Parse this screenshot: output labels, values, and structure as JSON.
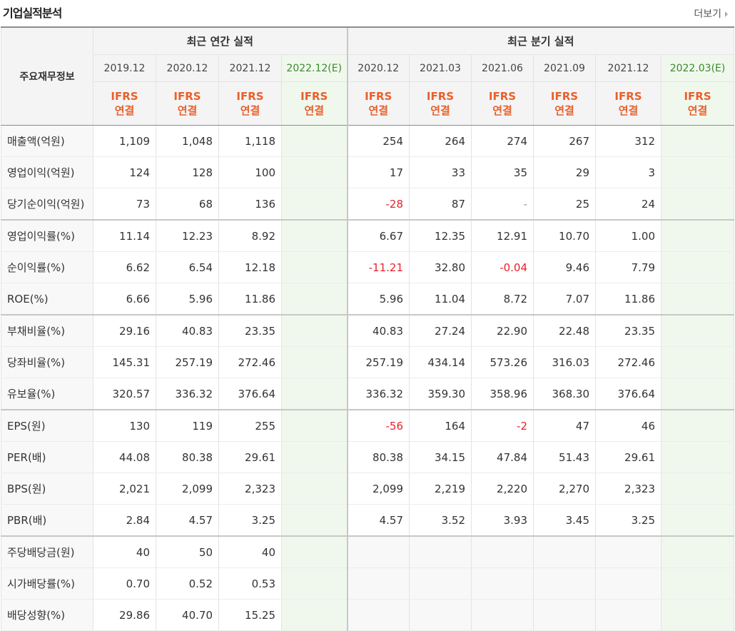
{
  "header": {
    "title": "기업실적분석",
    "more_label": "더보기"
  },
  "table": {
    "row_header_label": "주요재무정보",
    "groups": {
      "annual": "최근 연간 실적",
      "quarter": "최근 분기 실적"
    },
    "columns": [
      {
        "period": "2019.12",
        "basis_line1": "IFRS",
        "basis_line2": "연결"
      },
      {
        "period": "2020.12",
        "basis_line1": "IFRS",
        "basis_line2": "연결"
      },
      {
        "period": "2021.12",
        "basis_line1": "IFRS",
        "basis_line2": "연결"
      },
      {
        "period": "2022.12(E)",
        "basis_line1": "IFRS",
        "basis_line2": "연결"
      },
      {
        "period": "2020.12",
        "basis_line1": "IFRS",
        "basis_line2": "연결"
      },
      {
        "period": "2021.03",
        "basis_line1": "IFRS",
        "basis_line2": "연결"
      },
      {
        "period": "2021.06",
        "basis_line1": "IFRS",
        "basis_line2": "연결"
      },
      {
        "period": "2021.09",
        "basis_line1": "IFRS",
        "basis_line2": "연결"
      },
      {
        "period": "2021.12",
        "basis_line1": "IFRS",
        "basis_line2": "연결"
      },
      {
        "period": "2022.03(E)",
        "basis_line1": "IFRS",
        "basis_line2": "연결"
      }
    ],
    "rows": [
      {
        "label": "매출액(억원)",
        "values": [
          "1,109",
          "1,048",
          "1,118",
          "",
          "254",
          "264",
          "274",
          "267",
          "312",
          ""
        ]
      },
      {
        "label": "영업이익(억원)",
        "values": [
          "124",
          "128",
          "100",
          "",
          "17",
          "33",
          "35",
          "29",
          "3",
          ""
        ]
      },
      {
        "label": "당기순이익(억원)",
        "values": [
          "73",
          "68",
          "136",
          "",
          "-28",
          "87",
          "-",
          "25",
          "24",
          ""
        ]
      },
      {
        "label": "영업이익률(%)",
        "values": [
          "11.14",
          "12.23",
          "8.92",
          "",
          "6.67",
          "12.35",
          "12.91",
          "10.70",
          "1.00",
          ""
        ]
      },
      {
        "label": "순이익률(%)",
        "values": [
          "6.62",
          "6.54",
          "12.18",
          "",
          "-11.21",
          "32.80",
          "-0.04",
          "9.46",
          "7.79",
          ""
        ]
      },
      {
        "label": "ROE(%)",
        "values": [
          "6.66",
          "5.96",
          "11.86",
          "",
          "5.96",
          "11.04",
          "8.72",
          "7.07",
          "11.86",
          ""
        ]
      },
      {
        "label": "부채비율(%)",
        "values": [
          "29.16",
          "40.83",
          "23.35",
          "",
          "40.83",
          "27.24",
          "22.90",
          "22.48",
          "23.35",
          ""
        ]
      },
      {
        "label": "당좌비율(%)",
        "values": [
          "145.31",
          "257.19",
          "272.46",
          "",
          "257.19",
          "434.14",
          "573.26",
          "316.03",
          "272.46",
          ""
        ]
      },
      {
        "label": "유보율(%)",
        "values": [
          "320.57",
          "336.32",
          "376.64",
          "",
          "336.32",
          "359.30",
          "358.96",
          "368.30",
          "376.64",
          ""
        ]
      },
      {
        "label": "EPS(원)",
        "values": [
          "130",
          "119",
          "255",
          "",
          "-56",
          "164",
          "-2",
          "47",
          "46",
          ""
        ]
      },
      {
        "label": "PER(배)",
        "values": [
          "44.08",
          "80.38",
          "29.61",
          "",
          "80.38",
          "34.15",
          "47.84",
          "51.43",
          "29.61",
          ""
        ]
      },
      {
        "label": "BPS(원)",
        "values": [
          "2,021",
          "2,099",
          "2,323",
          "",
          "2,099",
          "2,219",
          "2,220",
          "2,270",
          "2,323",
          ""
        ]
      },
      {
        "label": "PBR(배)",
        "values": [
          "2.84",
          "4.57",
          "3.25",
          "",
          "4.57",
          "3.52",
          "3.93",
          "3.45",
          "3.25",
          ""
        ]
      },
      {
        "label": "주당배당금(원)",
        "values": [
          "40",
          "50",
          "40",
          "",
          "",
          "",
          "",
          "",
          "",
          ""
        ]
      },
      {
        "label": "시가배당률(%)",
        "values": [
          "0.70",
          "0.52",
          "0.53",
          "",
          "",
          "",
          "",
          "",
          "",
          ""
        ]
      },
      {
        "label": "배당성향(%)",
        "values": [
          "29.86",
          "40.70",
          "15.25",
          "",
          "",
          "",
          "",
          "",
          "",
          ""
        ]
      }
    ]
  },
  "colors": {
    "negative": "#e8222a",
    "ifrs_label": "#e8602c",
    "estimate_bg": "#f0f8ee",
    "estimate_text": "#3b8a2c"
  }
}
